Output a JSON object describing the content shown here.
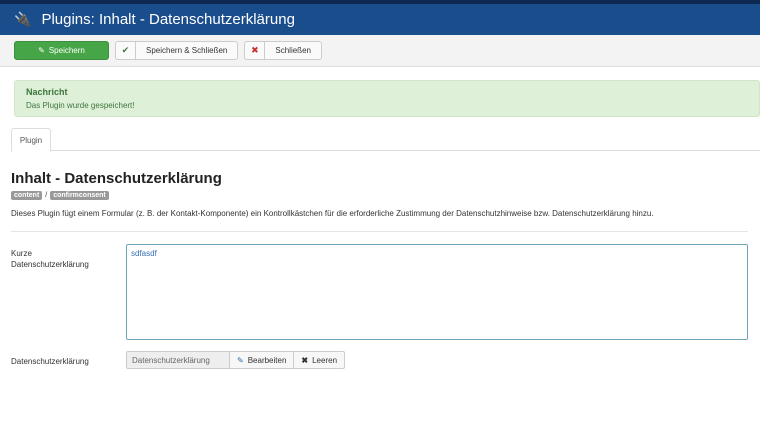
{
  "header": {
    "title": "Plugins: Inhalt - Datenschutzerklärung",
    "icon": "plug-icon"
  },
  "toolbar": {
    "save": "Speichern",
    "save_close": "Speichern & Schließen",
    "close": "Schließen"
  },
  "message": {
    "title": "Nachricht",
    "text": "Das Plugin wurde gespeichert!"
  },
  "tabs": [
    {
      "label": "Plugin"
    }
  ],
  "plugin": {
    "title": "Inhalt - Datenschutzerklärung",
    "badges": [
      "content",
      "confirmconsent"
    ],
    "separator": "/",
    "description": "Dieses Plugin fügt einem Formular (z. B. der Kontakt-Komponente) ein Kontrollkästchen für die erforderliche Zustimmung der Datenschutzhinweise bzw. Datenschutzerklärung hinzu."
  },
  "fields": {
    "short_label_1": "Kurze",
    "short_label_2": "Datenschutzerklärung",
    "short_value": "sdfasdf",
    "article_label": "Datenschutzerklärung",
    "article_value": "Datenschutzerklärung",
    "edit": "Bearbeiten",
    "clear": "Leeren"
  },
  "colors": {
    "header": "#1a4d8c",
    "save": "#46a546",
    "message_bg": "#dff0d8"
  }
}
